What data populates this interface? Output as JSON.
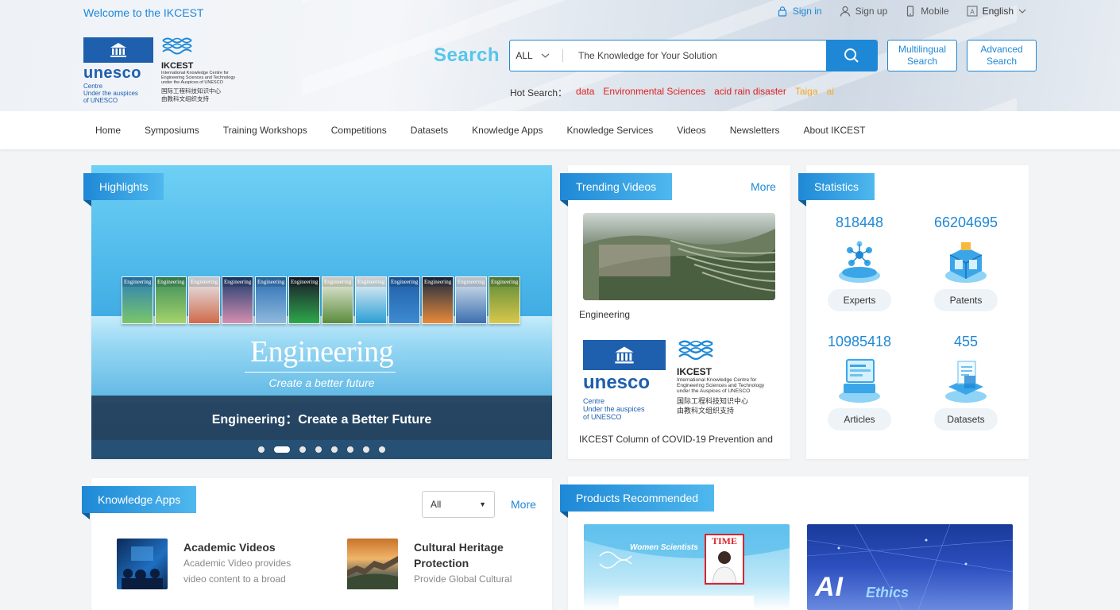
{
  "header": {
    "welcome": "Welcome to the IKCEST",
    "top_links": {
      "signin": "Sign in",
      "signup": "Sign up",
      "mobile": "Mobile",
      "language": "English"
    },
    "logos": {
      "unesco_word": "unesco",
      "unesco_sub": [
        "Centre",
        "Under the auspices",
        "of UNESCO"
      ],
      "ikcest_name": "IKCEST",
      "ikcest_desc": [
        "International Knowledge Centre for",
        "Engineering Sciences and Technology",
        "under the Auspices of UNESCO"
      ],
      "ikcest_cn": [
        "国际工程科技知识中心",
        "由教科文组织支持"
      ]
    },
    "search": {
      "label": "Search",
      "scope": "ALL",
      "placeholder": "The Knowledge for Your Solution",
      "multilingual": "Multilingual Search",
      "advanced": "Advanced Search"
    },
    "hot_search": {
      "label": "Hot Search：",
      "items": [
        "data",
        "Environmental Sciences",
        "acid rain disaster",
        "Taiga",
        "ai"
      ]
    }
  },
  "nav": [
    "Home",
    "Symposiums",
    "Training Workshops",
    "Competitions",
    "Datasets",
    "Knowledge Apps",
    "Knowledge Services",
    "Videos",
    "Newsletters",
    "About IKCEST"
  ],
  "highlights": {
    "ribbon": "Highlights",
    "banner_title": "Engineering",
    "banner_tagline": "Create a better future",
    "caption": "Engineering：Create a Better Future",
    "slide_count": 8,
    "active_slide": 1,
    "journal_label": "Engineering"
  },
  "trending": {
    "ribbon": "Trending Videos",
    "more": "More",
    "videos": [
      {
        "caption": "Engineering"
      },
      {
        "caption": "IKCEST Column of COVID-19 Prevention and"
      }
    ]
  },
  "statistics": {
    "ribbon": "Statistics",
    "items": [
      {
        "value": "818448",
        "label": "Experts"
      },
      {
        "value": "66204695",
        "label": "Patents"
      },
      {
        "value": "10985418",
        "label": "Articles"
      },
      {
        "value": "455",
        "label": "Datasets"
      }
    ]
  },
  "knowledge_apps": {
    "ribbon": "Knowledge Apps",
    "filter": "All",
    "more": "More",
    "apps": [
      {
        "title": "Academic Videos",
        "desc": [
          "Academic Video provides",
          "video content to a broad"
        ]
      },
      {
        "title": "Cultural Heritage Protection",
        "desc": [
          "Provide Global Cultural"
        ]
      }
    ]
  },
  "products": {
    "ribbon": "Products Recommended",
    "items": [
      {
        "title": "Women Scientists",
        "badge": "TIME"
      },
      {
        "title_a": "AI",
        "title_b": "Ethics"
      }
    ]
  },
  "colors": {
    "primary": "#1e88d6",
    "accent_light": "#55c5ec",
    "hot_red": "#e02020",
    "hot_orange": "#f5a623"
  }
}
